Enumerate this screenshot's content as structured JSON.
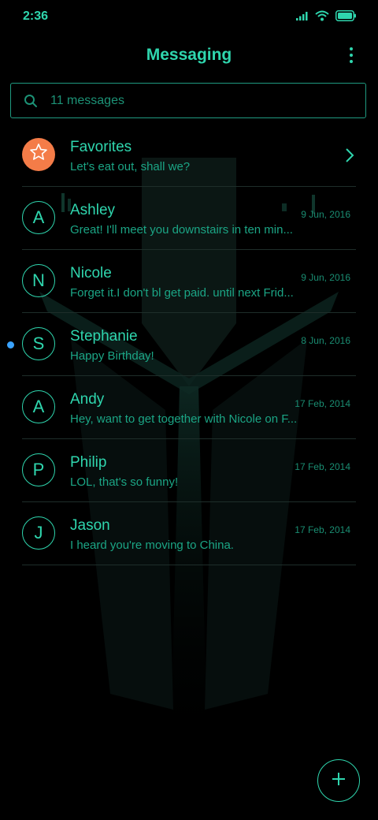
{
  "status": {
    "time": "2:36"
  },
  "header": {
    "title": "Messaging",
    "more_icon": "more-vertical-icon"
  },
  "search": {
    "placeholder": "11 messages",
    "icon": "search-icon"
  },
  "favorites": {
    "name": "Favorites",
    "preview": "Let's eat out, shall we?",
    "icon": "star-icon"
  },
  "conversations": [
    {
      "initial": "A",
      "name": "Ashley",
      "preview": "Great! I'll meet you downstairs in ten min...",
      "date": "9 Jun, 2016",
      "unread": false
    },
    {
      "initial": "N",
      "name": "Nicole",
      "preview": "Forget it.I don't bl get paid. until next Frid...",
      "date": "9 Jun, 2016",
      "unread": false
    },
    {
      "initial": "S",
      "name": "Stephanie",
      "preview": "Happy Birthday!",
      "date": "8 Jun, 2016",
      "unread": true
    },
    {
      "initial": "A",
      "name": "Andy",
      "preview": "Hey, want to get together with Nicole on F...",
      "date": "17 Feb, 2014",
      "unread": false
    },
    {
      "initial": "P",
      "name": "Philip",
      "preview": "LOL, that's so funny!",
      "date": "17 Feb, 2014",
      "unread": false
    },
    {
      "initial": "J",
      "name": "Jason",
      "preview": "I heard you're moving to China.",
      "date": "17 Feb, 2014",
      "unread": false
    }
  ],
  "fab": {
    "icon": "plus-icon"
  },
  "colors": {
    "accent": "#2fd6ae",
    "favorite": "#f47c48",
    "unread_dot": "#3aa3ff",
    "background": "#000000"
  }
}
